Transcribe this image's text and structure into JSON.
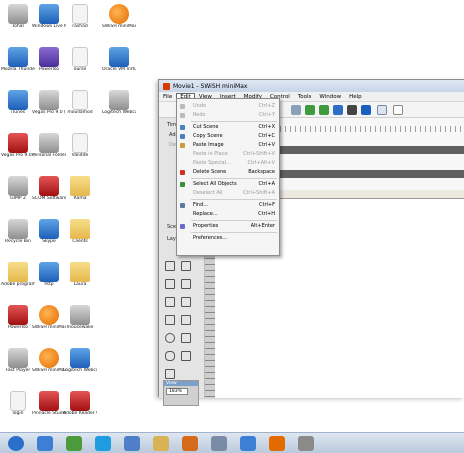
{
  "desktop": {
    "icons": [
      {
        "label": "Tohal",
        "kind": "gray",
        "col": 0,
        "row": 0
      },
      {
        "label": "Windows Live Mess…",
        "kind": "blue",
        "col": 1,
        "row": 0
      },
      {
        "label": "rashad",
        "kind": "doc",
        "col": 2,
        "row": 0
      },
      {
        "label": "SWiSH miniMax",
        "kind": "orange",
        "col": 3,
        "row": 0
      },
      {
        "label": "Mozilla Thunderbird",
        "kind": "blue",
        "col": 0,
        "row": 1
      },
      {
        "label": "PowerIso",
        "kind": "purple",
        "col": 1,
        "row": 1
      },
      {
        "label": "ourse",
        "kind": "doc",
        "col": 2,
        "row": 1
      },
      {
        "label": "Oracle VM VirtualBox",
        "kind": "blue",
        "col": 3,
        "row": 1
      },
      {
        "label": "iTunes",
        "kind": "blue",
        "col": 0,
        "row": 2
      },
      {
        "label": "Vegas Pro 9.0 (64 bit)",
        "kind": "gray",
        "col": 1,
        "row": 2
      },
      {
        "label": "moullamod",
        "kind": "doc",
        "col": 2,
        "row": 2
      },
      {
        "label": "Logitech Webca…",
        "kind": "gray",
        "col": 3,
        "row": 2
      },
      {
        "label": "Vegas Pro 9.0 (64 bit)",
        "kind": "red",
        "col": 0,
        "row": 3
      },
      {
        "label": "Personal Folder",
        "kind": "gray",
        "col": 1,
        "row": 3
      },
      {
        "label": "Validite",
        "kind": "doc",
        "col": 2,
        "row": 3
      },
      {
        "label": "GIMP 2",
        "kind": "gray",
        "col": 0,
        "row": 4
      },
      {
        "label": "SCOM Software",
        "kind": "red",
        "col": 1,
        "row": 4
      },
      {
        "label": "Rama",
        "kind": "folder",
        "col": 2,
        "row": 4
      },
      {
        "label": "Recycle Bin",
        "kind": "gray",
        "col": 0,
        "row": 5
      },
      {
        "label": "Skype",
        "kind": "blue",
        "col": 1,
        "row": 5
      },
      {
        "label": "Clients",
        "kind": "folder",
        "col": 2,
        "row": 5
      },
      {
        "label": "Adobe programs",
        "kind": "folder",
        "col": 0,
        "row": 6
      },
      {
        "label": "http",
        "kind": "blue",
        "col": 1,
        "row": 6
      },
      {
        "label": "Laura",
        "kind": "folder",
        "col": 2,
        "row": 6
      },
      {
        "label": "PowerIso",
        "kind": "red",
        "col": 0,
        "row": 7
      },
      {
        "label": "SWiSH miniMax",
        "kind": "orange",
        "col": 1,
        "row": 7
      },
      {
        "label": "mousewake",
        "kind": "gray",
        "col": 2,
        "row": 7
      },
      {
        "label": "Fast Player",
        "kind": "gray",
        "col": 0,
        "row": 8
      },
      {
        "label": "SWiSH miniMax",
        "kind": "orange",
        "col": 1,
        "row": 8
      },
      {
        "label": "Logitech Webcam HD",
        "kind": "blue",
        "col": 2,
        "row": 8
      },
      {
        "label": "login",
        "kind": "doc",
        "col": 0,
        "row": 9
      },
      {
        "label": "Pinnacle Studio",
        "kind": "red",
        "col": 1,
        "row": 9
      },
      {
        "label": "Adobe Reader 9",
        "kind": "red",
        "col": 2,
        "row": 9
      }
    ]
  },
  "app": {
    "title": "Movie1 - SWiSH miniMax",
    "menus": [
      "File",
      "Edit",
      "View",
      "Insert",
      "Modify",
      "Control",
      "Tools",
      "Window",
      "Help"
    ],
    "active_menu": "Edit",
    "left_panel": {
      "timeline_label": "Time…",
      "add_label": "Add",
      "del_label": "Del",
      "scene_label": "Sce…",
      "layout_label": "Layou",
      "view_label": "View",
      "zoom_value": "183%"
    }
  },
  "edit_menu": {
    "items": [
      {
        "label": "Undo",
        "shortcut": "Ctrl+Z",
        "enabled": false,
        "icon": "undo-icon"
      },
      {
        "label": "Redo",
        "shortcut": "Ctrl+Y",
        "enabled": false,
        "icon": "redo-icon"
      },
      {
        "sep": true
      },
      {
        "label": "Cut Scene",
        "shortcut": "Ctrl+X",
        "enabled": true,
        "icon": "cut-icon"
      },
      {
        "label": "Copy Scene",
        "shortcut": "Ctrl+C",
        "enabled": true,
        "icon": "copy-icon"
      },
      {
        "label": "Paste Image",
        "shortcut": "Ctrl+V",
        "enabled": true,
        "icon": "paste-icon"
      },
      {
        "label": "Paste in Place",
        "shortcut": "Ctrl+Shift+V",
        "enabled": false,
        "icon": ""
      },
      {
        "label": "Paste Special...",
        "shortcut": "Ctrl+Alt+V",
        "enabled": false,
        "icon": ""
      },
      {
        "label": "Delete Scene",
        "shortcut": "Backspace",
        "enabled": true,
        "icon": "delete-icon"
      },
      {
        "sep": true
      },
      {
        "label": "Select All Objects",
        "shortcut": "Ctrl+A",
        "enabled": true,
        "icon": "select-all-icon"
      },
      {
        "label": "Deselect All",
        "shortcut": "Ctrl+Shift+A",
        "enabled": false,
        "icon": ""
      },
      {
        "sep": true
      },
      {
        "label": "Find...",
        "shortcut": "Ctrl+F",
        "enabled": true,
        "icon": "find-icon"
      },
      {
        "label": "Replace...",
        "shortcut": "Ctrl+H",
        "enabled": true,
        "icon": ""
      },
      {
        "sep": true
      },
      {
        "label": "Properties",
        "shortcut": "Alt+Enter",
        "enabled": true,
        "icon": "properties-icon"
      },
      {
        "sep": true
      },
      {
        "label": "Preferences...",
        "shortcut": "",
        "enabled": true,
        "icon": ""
      }
    ]
  },
  "taskbar": {
    "buttons": [
      "start-orb-icon",
      "ie-icon",
      "chrome-icon",
      "skype-icon",
      "itunes-icon",
      "explorer-icon",
      "media-player-icon",
      "files-icon",
      "ie-icon-2",
      "swish-icon",
      "tools-icon"
    ]
  },
  "colors": {
    "accent": "#3a6fb0",
    "swish_orange": "#e36a00"
  }
}
